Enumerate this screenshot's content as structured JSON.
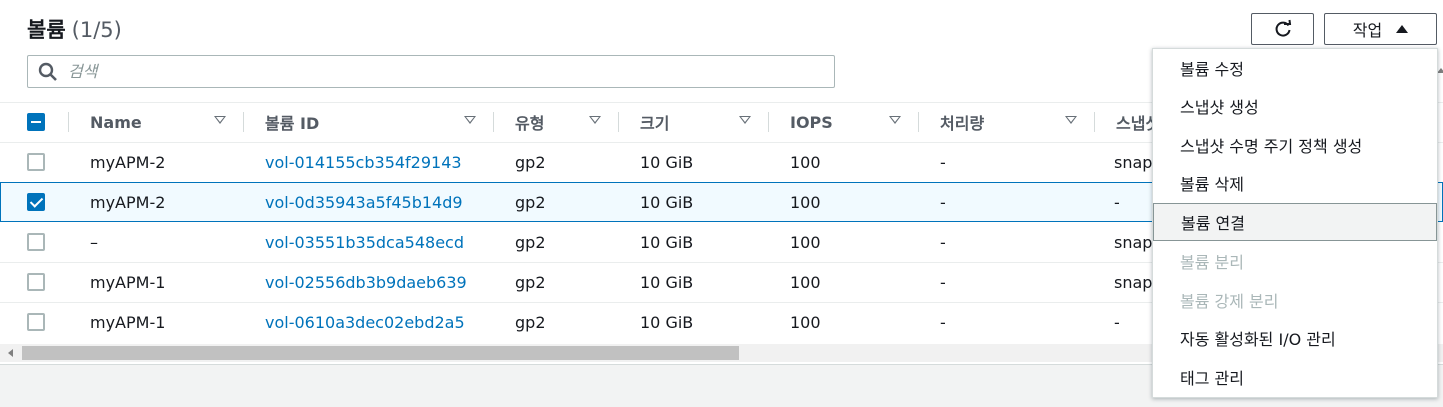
{
  "header": {
    "title": "볼륨",
    "count": "(1/5)"
  },
  "toolbar": {
    "actions_label": "작업"
  },
  "search": {
    "placeholder": "검색"
  },
  "columns": [
    "Name",
    "볼륨 ID",
    "유형",
    "크기",
    "IOPS",
    "처리량",
    "스냅샷"
  ],
  "rows": [
    {
      "name": "myAPM-2",
      "volume_id": "vol-014155cb354f29143",
      "type": "gp2",
      "size": "10 GiB",
      "iops": "100",
      "throughput": "-",
      "snapshot": "snap",
      "checked": false
    },
    {
      "name": "myAPM-2",
      "volume_id": "vol-0d35943a5f45b14d9",
      "type": "gp2",
      "size": "10 GiB",
      "iops": "100",
      "throughput": "-",
      "snapshot": "-",
      "checked": true
    },
    {
      "name": "–",
      "volume_id": "vol-03551b35dca548ecd",
      "type": "gp2",
      "size": "10 GiB",
      "iops": "100",
      "throughput": "-",
      "snapshot": "snap",
      "checked": false
    },
    {
      "name": "myAPM-1",
      "volume_id": "vol-02556db3b9daeb639",
      "type": "gp2",
      "size": "10 GiB",
      "iops": "100",
      "throughput": "-",
      "snapshot": "snap",
      "checked": false
    },
    {
      "name": "myAPM-1",
      "volume_id": "vol-0610a3dec02ebd2a5",
      "type": "gp2",
      "size": "10 GiB",
      "iops": "100",
      "throughput": "-",
      "snapshot": "-",
      "checked": false
    }
  ],
  "menu": {
    "items": [
      {
        "label": "볼륨 수정",
        "state": "normal"
      },
      {
        "label": "스냅샷 생성",
        "state": "normal"
      },
      {
        "label": "스냅샷 수명 주기 정책 생성",
        "state": "normal"
      },
      {
        "label": "볼륨 삭제",
        "state": "normal"
      },
      {
        "label": "볼륨 연결",
        "state": "hover"
      },
      {
        "label": "볼륨 분리",
        "state": "disabled"
      },
      {
        "label": "볼륨 강제 분리",
        "state": "disabled"
      },
      {
        "label": "자동 활성화된 I/O 관리",
        "state": "normal"
      },
      {
        "label": "태그 관리",
        "state": "normal"
      }
    ]
  },
  "colors": {
    "accent": "#0073bb",
    "selected_bg": "#f1faff",
    "disabled_text": "#aab7b8"
  }
}
